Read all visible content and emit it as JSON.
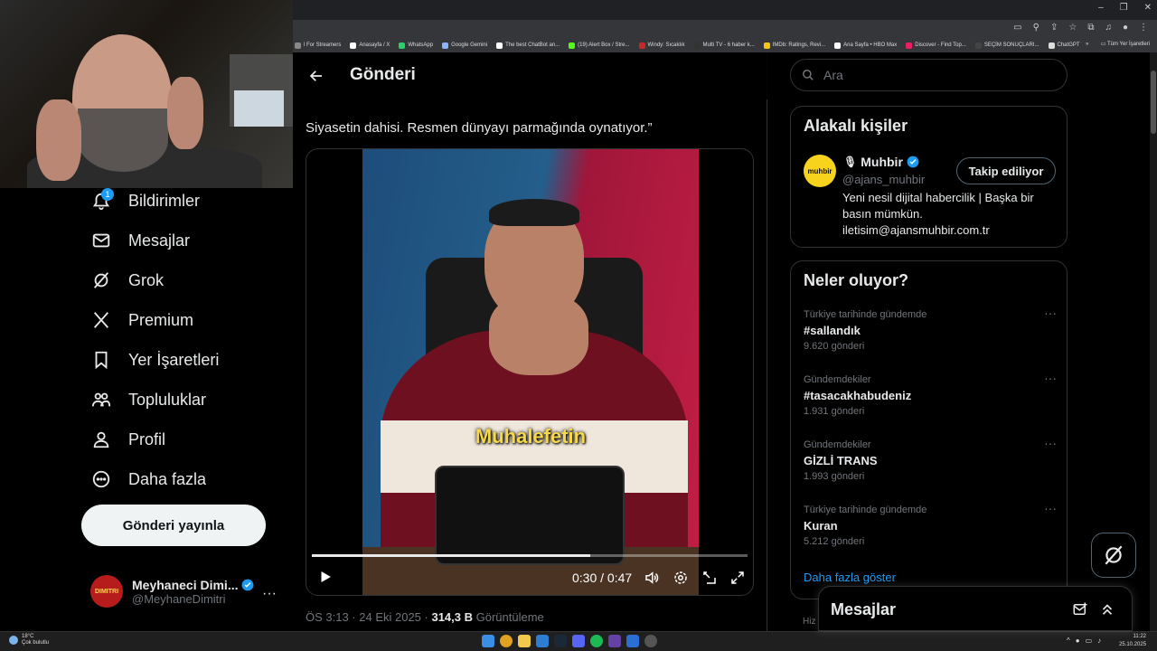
{
  "browser": {
    "bookmarks": [
      {
        "label": "l For Streamers",
        "color": "#888888"
      },
      {
        "label": "Anasayfa / X",
        "color": "#ffffff"
      },
      {
        "label": "WhatsApp",
        "color": "#25d366"
      },
      {
        "label": "Google Gemini",
        "color": "#8ab4f8"
      },
      {
        "label": "The best ChatBot an...",
        "color": "#ffffff"
      },
      {
        "label": "(19) Alert Box / Stre...",
        "color": "#53fc18"
      },
      {
        "label": "Windy: Sıcaklık",
        "color": "#c62828"
      },
      {
        "label": "Multi TV - 6 haber k...",
        "color": "#333333"
      },
      {
        "label": "IMDb: Ratings, Revi...",
        "color": "#f5c518"
      },
      {
        "label": "Ana Sayfa • HBO Max",
        "color": "#ffffff"
      },
      {
        "label": "Discover - Find Top...",
        "color": "#e91e63"
      },
      {
        "label": "SEÇİM SONUÇLARI...",
        "color": "#444444"
      },
      {
        "label": "ChatGPT",
        "color": "#dddddd"
      }
    ],
    "bookmarks_more": "»",
    "all_bookmarks": "Tüm Yer İşaretleri"
  },
  "sidebar": {
    "notif_badge": "1",
    "items": [
      {
        "label": "Bildirimler",
        "icon": "bell-icon"
      },
      {
        "label": "Mesajlar",
        "icon": "mail-icon"
      },
      {
        "label": "Grok",
        "icon": "grok-icon"
      },
      {
        "label": "Premium",
        "icon": "x-logo-icon"
      },
      {
        "label": "Yer İşaretleri",
        "icon": "bookmark-icon"
      },
      {
        "label": "Topluluklar",
        "icon": "communities-icon"
      },
      {
        "label": "Profil",
        "icon": "profile-icon"
      },
      {
        "label": "Daha fazla",
        "icon": "more-circle-icon"
      }
    ],
    "post_button": "Gönderi yayınla",
    "profile": {
      "name": "Meyhaneci Dimi...",
      "handle": "@MeyhaneDimitri",
      "avatar_text": "DIMITRI",
      "more": "···"
    }
  },
  "main": {
    "title": "Gönderi",
    "tweet_text": "Siyasetin dahisi. Resmen dünyayı parmağında oynatıyor.”",
    "video": {
      "caption": "Muhalefetin",
      "current_time": "0:30",
      "duration": "0:47",
      "time_text": "0:30 / 0:47",
      "progress_fraction": 0.64
    },
    "meta": {
      "time": "ÖS 3:13 · 24 Eki 2025 · ",
      "views": "314,3 B",
      "views_label": " Görüntüleme"
    }
  },
  "right": {
    "search_placeholder": "Ara",
    "related": {
      "title": "Alakalı kişiler",
      "name": "Muhbir",
      "handle": "@ajans_muhbir",
      "avatar_text": "muhbir",
      "follow_label": "Takip ediliyor",
      "bio": "Yeni nesil dijital habercilik | Başka bir basın mümkün. iletisim@ajansmuhbir.com.tr"
    },
    "trends_card": {
      "title": "Neler oluyor?",
      "trends": [
        {
          "context": "Türkiye tarihinde gündemde",
          "name": "#sallandık",
          "count": "9.620 gönderi"
        },
        {
          "context": "Gündemdekiler",
          "name": "#tasacakhabudeniz",
          "count": "1.931 gönderi"
        },
        {
          "context": "Gündemdekiler",
          "name": "GİZLİ TRANS",
          "count": "1.993 gönderi"
        },
        {
          "context": "Türkiye tarihinde gündemde",
          "name": "Kuran",
          "count": "5.212 gönderi"
        }
      ],
      "show_more": "Daha fazla göster"
    },
    "messages_drawer": "Mesajlar",
    "partial_text": "Hiz"
  },
  "taskbar": {
    "weather_temp": "18°C",
    "weather_desc": "Çok bulutlu",
    "time": "11:22",
    "date": "25.10.2025"
  },
  "colors": {
    "accent": "#1d9bf0",
    "text": "#e7e9ea",
    "muted": "#71767b",
    "border": "#2f3336"
  }
}
